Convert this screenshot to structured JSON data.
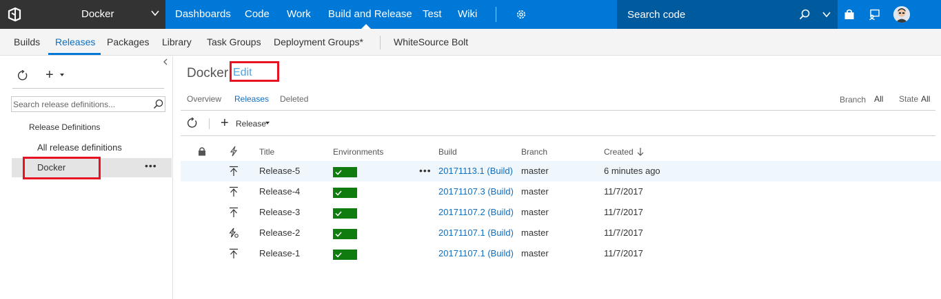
{
  "topbar": {
    "project": "Docker",
    "nav": [
      "Dashboards",
      "Code",
      "Work",
      "Build and Release",
      "Test",
      "Wiki"
    ],
    "active_nav": "Build and Release",
    "search_placeholder": "Search code"
  },
  "hub": {
    "items": [
      "Builds",
      "Releases",
      "Packages",
      "Library",
      "Task Groups",
      "Deployment Groups*"
    ],
    "extension": "WhiteSource Bolt",
    "active": "Releases"
  },
  "sidebar": {
    "search_placeholder": "Search release definitions...",
    "section_title": "Release Definitions",
    "all_label": "All release definitions",
    "selected_definition": "Docker",
    "more_label": "•••"
  },
  "main": {
    "title": "Docker",
    "edit_label": "Edit",
    "tabs": [
      "Overview",
      "Releases",
      "Deleted"
    ],
    "active_tab": "Releases",
    "branch_label": "Branch",
    "branch_value": "All",
    "state_label": "State",
    "state_value": "All",
    "new_release_label": "Release"
  },
  "table": {
    "columns": [
      "Title",
      "Environments",
      "Build",
      "Branch",
      "Created"
    ],
    "sort_column": "Created",
    "more_label": "•••",
    "rows": [
      {
        "title": "Release-5",
        "build": "20171113.1 (Build)",
        "branch": "master",
        "created": "6 minutes ago",
        "trigger": "manual",
        "env_status": "succeeded"
      },
      {
        "title": "Release-4",
        "build": "20171107.3 (Build)",
        "branch": "master",
        "created": "11/7/2017",
        "trigger": "manual",
        "env_status": "succeeded"
      },
      {
        "title": "Release-3",
        "build": "20171107.2 (Build)",
        "branch": "master",
        "created": "11/7/2017",
        "trigger": "manual",
        "env_status": "succeeded"
      },
      {
        "title": "Release-2",
        "build": "20171107.1 (Build)",
        "branch": "master",
        "created": "11/7/2017",
        "trigger": "automatic",
        "env_status": "succeeded"
      },
      {
        "title": "Release-1",
        "build": "20171107.1 (Build)",
        "branch": "master",
        "created": "11/7/2017",
        "trigger": "manual",
        "env_status": "succeeded"
      }
    ]
  },
  "colors": {
    "brand_blue": "#0078d7",
    "dark_header": "#333333",
    "success_green": "#107c10",
    "highlight_red": "#e81123",
    "link_blue": "#106ebe"
  }
}
